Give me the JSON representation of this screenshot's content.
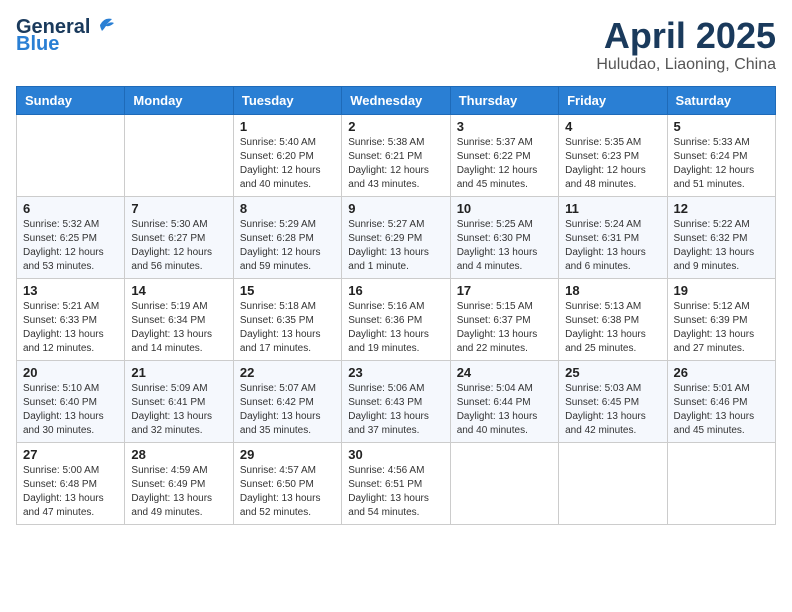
{
  "header": {
    "logo": {
      "general": "General",
      "blue": "Blue"
    },
    "title": "April 2025",
    "location": "Huludao, Liaoning, China"
  },
  "weekdays": [
    "Sunday",
    "Monday",
    "Tuesday",
    "Wednesday",
    "Thursday",
    "Friday",
    "Saturday"
  ],
  "weeks": [
    [
      {
        "day": "",
        "sunrise": "",
        "sunset": "",
        "daylight": ""
      },
      {
        "day": "",
        "sunrise": "",
        "sunset": "",
        "daylight": ""
      },
      {
        "day": "1",
        "sunrise": "Sunrise: 5:40 AM",
        "sunset": "Sunset: 6:20 PM",
        "daylight": "Daylight: 12 hours and 40 minutes."
      },
      {
        "day": "2",
        "sunrise": "Sunrise: 5:38 AM",
        "sunset": "Sunset: 6:21 PM",
        "daylight": "Daylight: 12 hours and 43 minutes."
      },
      {
        "day": "3",
        "sunrise": "Sunrise: 5:37 AM",
        "sunset": "Sunset: 6:22 PM",
        "daylight": "Daylight: 12 hours and 45 minutes."
      },
      {
        "day": "4",
        "sunrise": "Sunrise: 5:35 AM",
        "sunset": "Sunset: 6:23 PM",
        "daylight": "Daylight: 12 hours and 48 minutes."
      },
      {
        "day": "5",
        "sunrise": "Sunrise: 5:33 AM",
        "sunset": "Sunset: 6:24 PM",
        "daylight": "Daylight: 12 hours and 51 minutes."
      }
    ],
    [
      {
        "day": "6",
        "sunrise": "Sunrise: 5:32 AM",
        "sunset": "Sunset: 6:25 PM",
        "daylight": "Daylight: 12 hours and 53 minutes."
      },
      {
        "day": "7",
        "sunrise": "Sunrise: 5:30 AM",
        "sunset": "Sunset: 6:27 PM",
        "daylight": "Daylight: 12 hours and 56 minutes."
      },
      {
        "day": "8",
        "sunrise": "Sunrise: 5:29 AM",
        "sunset": "Sunset: 6:28 PM",
        "daylight": "Daylight: 12 hours and 59 minutes."
      },
      {
        "day": "9",
        "sunrise": "Sunrise: 5:27 AM",
        "sunset": "Sunset: 6:29 PM",
        "daylight": "Daylight: 13 hours and 1 minute."
      },
      {
        "day": "10",
        "sunrise": "Sunrise: 5:25 AM",
        "sunset": "Sunset: 6:30 PM",
        "daylight": "Daylight: 13 hours and 4 minutes."
      },
      {
        "day": "11",
        "sunrise": "Sunrise: 5:24 AM",
        "sunset": "Sunset: 6:31 PM",
        "daylight": "Daylight: 13 hours and 6 minutes."
      },
      {
        "day": "12",
        "sunrise": "Sunrise: 5:22 AM",
        "sunset": "Sunset: 6:32 PM",
        "daylight": "Daylight: 13 hours and 9 minutes."
      }
    ],
    [
      {
        "day": "13",
        "sunrise": "Sunrise: 5:21 AM",
        "sunset": "Sunset: 6:33 PM",
        "daylight": "Daylight: 13 hours and 12 minutes."
      },
      {
        "day": "14",
        "sunrise": "Sunrise: 5:19 AM",
        "sunset": "Sunset: 6:34 PM",
        "daylight": "Daylight: 13 hours and 14 minutes."
      },
      {
        "day": "15",
        "sunrise": "Sunrise: 5:18 AM",
        "sunset": "Sunset: 6:35 PM",
        "daylight": "Daylight: 13 hours and 17 minutes."
      },
      {
        "day": "16",
        "sunrise": "Sunrise: 5:16 AM",
        "sunset": "Sunset: 6:36 PM",
        "daylight": "Daylight: 13 hours and 19 minutes."
      },
      {
        "day": "17",
        "sunrise": "Sunrise: 5:15 AM",
        "sunset": "Sunset: 6:37 PM",
        "daylight": "Daylight: 13 hours and 22 minutes."
      },
      {
        "day": "18",
        "sunrise": "Sunrise: 5:13 AM",
        "sunset": "Sunset: 6:38 PM",
        "daylight": "Daylight: 13 hours and 25 minutes."
      },
      {
        "day": "19",
        "sunrise": "Sunrise: 5:12 AM",
        "sunset": "Sunset: 6:39 PM",
        "daylight": "Daylight: 13 hours and 27 minutes."
      }
    ],
    [
      {
        "day": "20",
        "sunrise": "Sunrise: 5:10 AM",
        "sunset": "Sunset: 6:40 PM",
        "daylight": "Daylight: 13 hours and 30 minutes."
      },
      {
        "day": "21",
        "sunrise": "Sunrise: 5:09 AM",
        "sunset": "Sunset: 6:41 PM",
        "daylight": "Daylight: 13 hours and 32 minutes."
      },
      {
        "day": "22",
        "sunrise": "Sunrise: 5:07 AM",
        "sunset": "Sunset: 6:42 PM",
        "daylight": "Daylight: 13 hours and 35 minutes."
      },
      {
        "day": "23",
        "sunrise": "Sunrise: 5:06 AM",
        "sunset": "Sunset: 6:43 PM",
        "daylight": "Daylight: 13 hours and 37 minutes."
      },
      {
        "day": "24",
        "sunrise": "Sunrise: 5:04 AM",
        "sunset": "Sunset: 6:44 PM",
        "daylight": "Daylight: 13 hours and 40 minutes."
      },
      {
        "day": "25",
        "sunrise": "Sunrise: 5:03 AM",
        "sunset": "Sunset: 6:45 PM",
        "daylight": "Daylight: 13 hours and 42 minutes."
      },
      {
        "day": "26",
        "sunrise": "Sunrise: 5:01 AM",
        "sunset": "Sunset: 6:46 PM",
        "daylight": "Daylight: 13 hours and 45 minutes."
      }
    ],
    [
      {
        "day": "27",
        "sunrise": "Sunrise: 5:00 AM",
        "sunset": "Sunset: 6:48 PM",
        "daylight": "Daylight: 13 hours and 47 minutes."
      },
      {
        "day": "28",
        "sunrise": "Sunrise: 4:59 AM",
        "sunset": "Sunset: 6:49 PM",
        "daylight": "Daylight: 13 hours and 49 minutes."
      },
      {
        "day": "29",
        "sunrise": "Sunrise: 4:57 AM",
        "sunset": "Sunset: 6:50 PM",
        "daylight": "Daylight: 13 hours and 52 minutes."
      },
      {
        "day": "30",
        "sunrise": "Sunrise: 4:56 AM",
        "sunset": "Sunset: 6:51 PM",
        "daylight": "Daylight: 13 hours and 54 minutes."
      },
      {
        "day": "",
        "sunrise": "",
        "sunset": "",
        "daylight": ""
      },
      {
        "day": "",
        "sunrise": "",
        "sunset": "",
        "daylight": ""
      },
      {
        "day": "",
        "sunrise": "",
        "sunset": "",
        "daylight": ""
      }
    ]
  ]
}
